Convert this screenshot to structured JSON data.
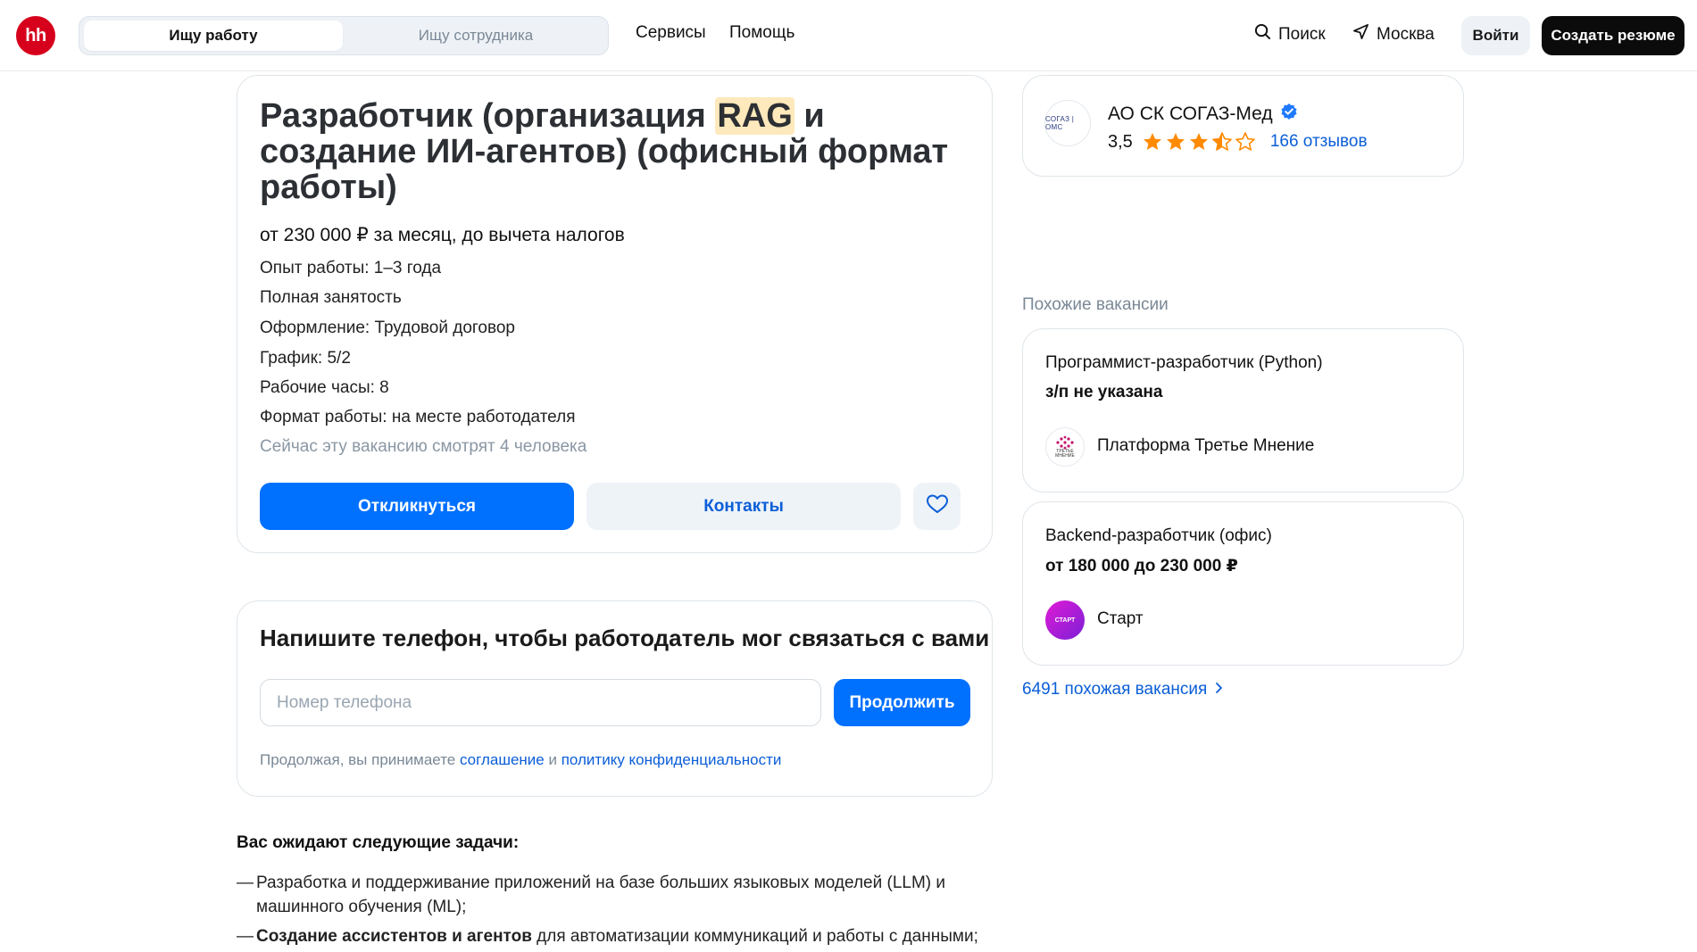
{
  "header": {
    "logo_text": "hh",
    "switch": {
      "active": "Ищу работу",
      "inactive": "Ищу сотрудника"
    },
    "nav": [
      "Сервисы",
      "Помощь"
    ],
    "search_label": "Поиск",
    "location": "Москва",
    "login": "Войти",
    "create_resume": "Создать резюме"
  },
  "vacancy": {
    "title_before": "Разработчик (организация ",
    "title_highlight": "RAG",
    "title_after": " и создание ИИ-агентов) (офисный формат работы)",
    "salary": "от 230 000 ₽ за месяц, до вычета налогов",
    "meta": [
      "Опыт работы: 1–3 года",
      "Полная занятость",
      "Оформление: Трудовой договор",
      "График: 5/2",
      "Рабочие часы: 8",
      "Формат работы: на месте работодателя"
    ],
    "viewers": "Сейчас эту вакансию смотрят 4 человека",
    "apply": "Откликнуться",
    "contacts": "Контакты"
  },
  "phone_form": {
    "title": "Напишите телефон, чтобы работодатель мог связаться с вами",
    "placeholder": "Номер телефона",
    "continue": "Продолжить",
    "agree_prefix": "Продолжая, вы принимаете ",
    "agree_link1": "соглашение",
    "agree_mid": " и ",
    "agree_link2": "политику конфиденциальности"
  },
  "description": {
    "heading": "Вас ожидают следующие задачи:",
    "dash": "—",
    "item1": "Разработка и поддерживание приложений на базе больших языковых моделей (LLM) и машинного обучения (ML);",
    "item2_bold": "Создание ассистентов и агентов",
    "item2_rest": " для автоматизации коммуникаций и работы с данными;"
  },
  "employer": {
    "logo_text": "СОГАЗ | ОМС",
    "name": "АО СК СОГАЗ-Мед",
    "rating": "3,5",
    "rating_value": 3.5,
    "reviews": "166 отзывов"
  },
  "similar": {
    "heading": "Похожие вакансии",
    "items": [
      {
        "title": "Программист-разработчик (Python)",
        "salary": "з/п не указана",
        "company": "Платформа Третье Мнение",
        "logo_text": "ТРЕТЬЕ МНЕНИЕ"
      },
      {
        "title": "Backend-разработчик (офис)",
        "salary": "от 180 000 до 230 000 ₽",
        "company": "Старт",
        "logo_text": "СТАРТ"
      }
    ],
    "more": "6491 похожая вакансия"
  },
  "colors": {
    "brand_red": "#d6001c",
    "primary_blue": "#0070ff",
    "link_blue": "#0b5ed7",
    "star_orange": "#ff8a00"
  }
}
